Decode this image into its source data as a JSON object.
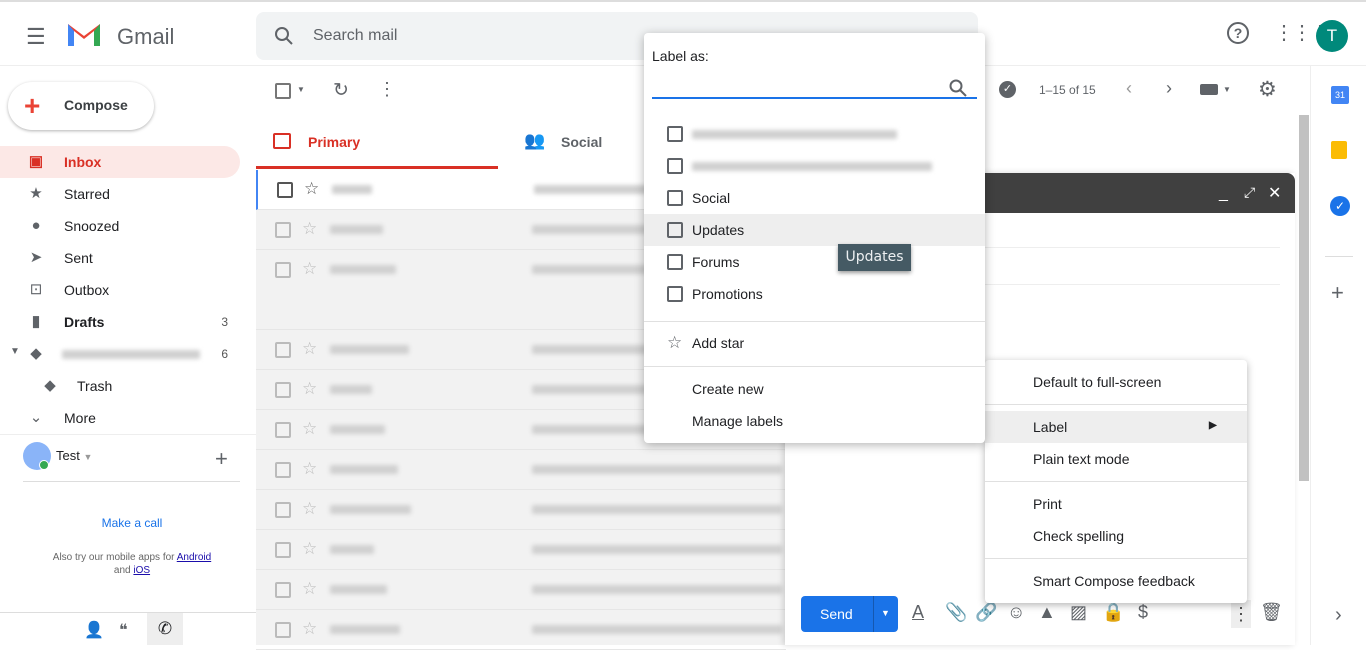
{
  "header": {
    "app_name": "Gmail",
    "search_placeholder": "Search mail",
    "avatar_letter": "T"
  },
  "sidebar": {
    "compose": "Compose",
    "items": [
      {
        "label": "Inbox",
        "icon": "inbox-icon",
        "active": true
      },
      {
        "label": "Starred",
        "icon": "star-icon"
      },
      {
        "label": "Snoozed",
        "icon": "clock-icon"
      },
      {
        "label": "Sent",
        "icon": "send-icon"
      },
      {
        "label": "Outbox",
        "icon": "outbox-icon"
      },
      {
        "label": "Drafts",
        "icon": "draft-icon",
        "count": "3"
      },
      {
        "label": "",
        "icon": "label-icon",
        "count": "6"
      },
      {
        "label": "Trash",
        "icon": "label-icon"
      },
      {
        "label": "More",
        "icon": "chevron-down-icon"
      }
    ],
    "hangouts": {
      "user": "Test",
      "make_call": "Make a call",
      "mobile_text": "Also try our mobile apps for",
      "android": "Android",
      "and": "and",
      "ios": "iOS"
    }
  },
  "toolbar": {
    "pagination": "1–15 of 15"
  },
  "tabs": [
    {
      "label": "Primary",
      "active": true
    },
    {
      "label": "Social"
    }
  ],
  "label_popup": {
    "title": "Label as:",
    "search_value": "",
    "options": [
      {
        "label": ""
      },
      {
        "label": ""
      },
      {
        "label": "Social"
      },
      {
        "label": "Updates",
        "hover": true
      },
      {
        "label": "Forums"
      },
      {
        "label": "Promotions"
      }
    ],
    "add_star": "Add star",
    "create_new": "Create new",
    "manage_labels": "Manage labels"
  },
  "tooltip": "Updates",
  "more_menu": {
    "items": [
      "Default to full-screen",
      "Label",
      "Plain text mode",
      "Print",
      "Check spelling",
      "Smart Compose feedback"
    ]
  },
  "compose": {
    "send": "Send"
  },
  "colors": {
    "accent": "#1a73e8",
    "primary_red": "#d93025",
    "tooltip_bg": "#455a64",
    "compose_header": "#404040"
  }
}
